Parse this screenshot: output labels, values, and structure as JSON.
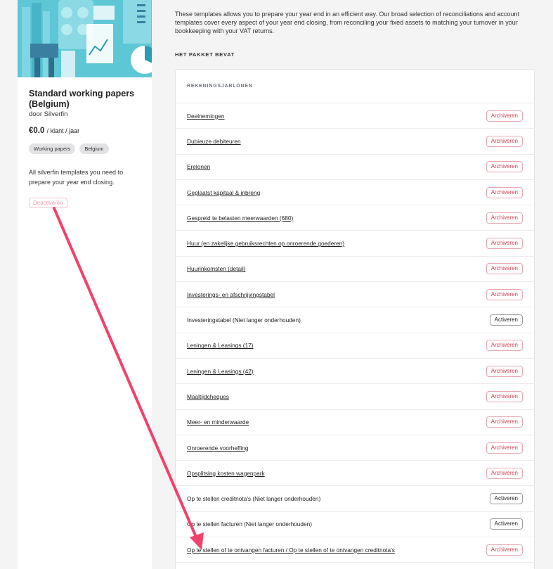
{
  "card": {
    "title": "Standard working papers (Belgium)",
    "author": "door Silverfin",
    "price": "€0.0",
    "price_unit": "/ klant / jaar",
    "tags": [
      "Working papers",
      "Belgium"
    ],
    "description": "All silverfin templates you need to prepare your year end closing.",
    "deactivate_label": "Deactiveren"
  },
  "intro": "These templates allows you to prepare your year end in an efficient way. Our broad selection of reconciliations and account templates cover every aspect of your year end closing, from reconciling your fixed assets to matching your turnover in your bookkeeping with your VAT returns.",
  "package_label": "HET PAKKET BEVAT",
  "panel": {
    "heading": "REKENINGSJABLONEN",
    "rows": [
      {
        "name": "Deelnemingen",
        "action": "Archiveren"
      },
      {
        "name": "Dubieuze debiteuren",
        "action": "Archiveren"
      },
      {
        "name": "Erelonen",
        "action": "Archiveren"
      },
      {
        "name": "Geplaatst kapitaal & inbreng",
        "action": "Archiveren"
      },
      {
        "name": "Gespreid te belasten meerwaarden (680)",
        "action": "Archiveren"
      },
      {
        "name": "Huur (en zakelijke gebruiksrechten op onroerende goederen)",
        "action": "Archiveren"
      },
      {
        "name": "Huurinkomsten (detail)",
        "action": "Archiveren"
      },
      {
        "name": "Investerings- en afschrijvingstabel",
        "action": "Archiveren"
      },
      {
        "name": "Investeringstabel (Niet langer onderhouden)",
        "action": "Activeren"
      },
      {
        "name": "Leningen & Leasings (17)",
        "action": "Archiveren"
      },
      {
        "name": "Leningen & Leasings (42)",
        "action": "Archiveren"
      },
      {
        "name": "Maaltijdcheques",
        "action": "Archiveren"
      },
      {
        "name": "Meer- en minderwaarde",
        "action": "Archiveren"
      },
      {
        "name": "Onroerende voorheffing",
        "action": "Archiveren"
      },
      {
        "name": "Opsplitsing kosten wagenpark",
        "action": "Archiveren"
      },
      {
        "name": "Op te stellen creditnota's (Niet langer onderhouden)",
        "action": "Activeren"
      },
      {
        "name": "Op te stellen facturen (Niet langer onderhouden)",
        "action": "Activeren"
      },
      {
        "name": "Op te stellen of te ontvangen facturen / Op te stellen of te ontvangen creditnota's",
        "action": "Archiveren"
      }
    ]
  },
  "colors": {
    "hero": "#5ec7d6",
    "archive": "#d63d52",
    "arrow": "#f2426a"
  }
}
